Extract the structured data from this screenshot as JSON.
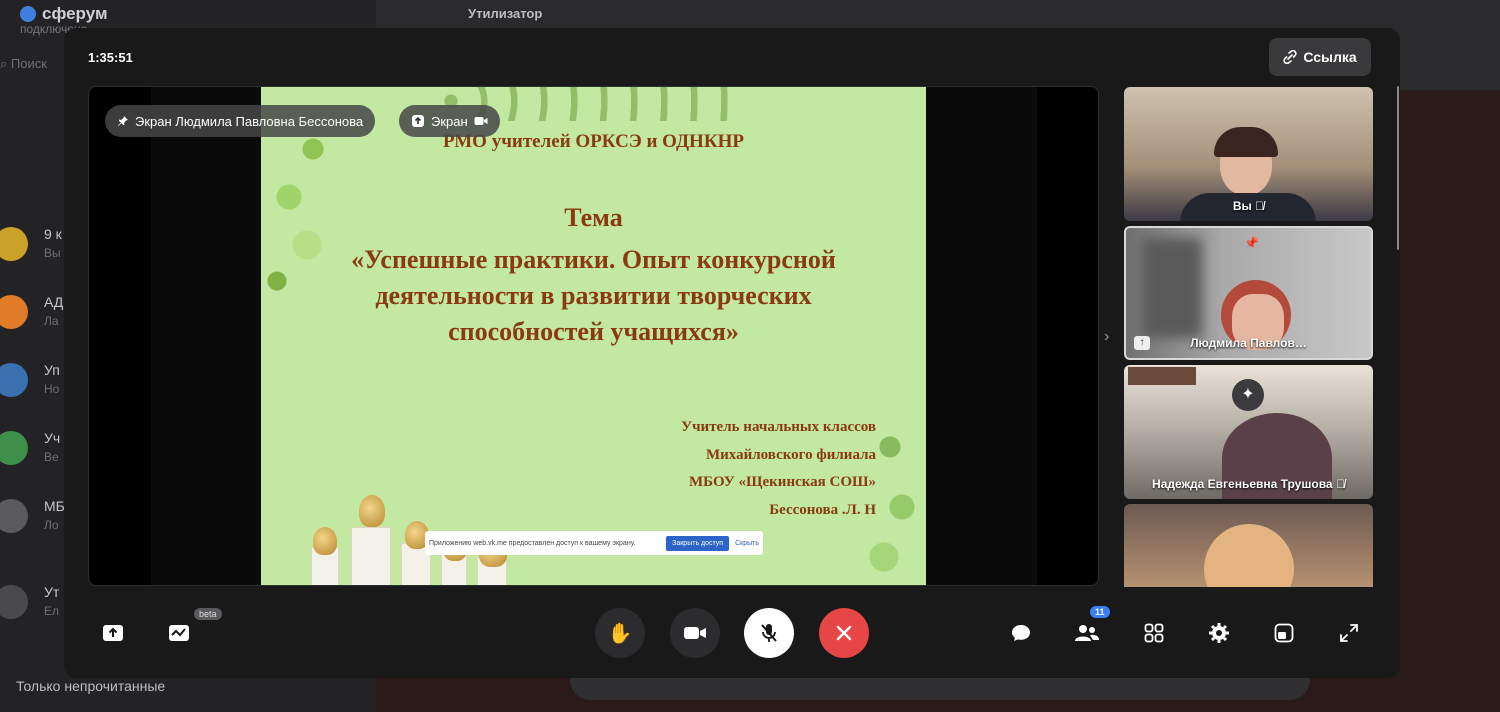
{
  "background_app": {
    "brand": "сферум",
    "subtitle": "подключено",
    "search_placeholder": "Поиск",
    "chat_title": "Утилизатор",
    "chat_subtitle": "",
    "chats": [
      {
        "name": "9 к",
        "preview": "Вы",
        "color": "#c9a227"
      },
      {
        "name": "АД",
        "preview": "Ла",
        "color": "#e07b2a"
      },
      {
        "name": "Уп",
        "preview": "Но",
        "color": "#3a6fb0"
      },
      {
        "name": "Уч",
        "preview": "Ве",
        "color": "#3e8f4a"
      },
      {
        "name": "МБ",
        "preview": "Ло",
        "color": "#5a5a5e"
      },
      {
        "name": "Ут",
        "preview": "Ел",
        "color": "#4a4a4e"
      }
    ],
    "unread_filter": "Только непрочитанные"
  },
  "call": {
    "timer": "1:35:51",
    "link_label": "Ссылка",
    "pinned_chip": "Экран Людмила Павловна Бессонова",
    "screen_chip": "Экран",
    "slide": {
      "header": "РМО учителей ОРКСЭ  и ОДНКНР",
      "topic_label": "Тема",
      "topic_lines": [
        "«Успешные практики. Опыт конкурсной",
        "деятельности в развитии творческих",
        "способностей учащихся»"
      ],
      "author_lines": [
        "Учитель начальных классов",
        "Михайловского филиала",
        "МБОУ «Щекинская СОШ»",
        "Бессонова .Л. Н"
      ]
    },
    "share_notice": {
      "text": "Приложению web.vk.me предоставлен доступ к вашему экрану.",
      "stop_button": "Закрыть доступ",
      "hide_link": "Скрыть"
    },
    "participants": [
      {
        "name": "Вы",
        "muted": true,
        "bg": "#a99a86"
      },
      {
        "name": "Людмила Павлов…",
        "muted": false,
        "bg": "#9c9c9c"
      },
      {
        "name": "Надежда Евгеньевна Трушова",
        "muted": true,
        "bg": "#8a8680"
      },
      {
        "name": "",
        "muted": false,
        "bg": "#6a5a50"
      }
    ],
    "toolbar": {
      "share_icon": "share-screen-icon",
      "effects_icon": "effects-icon",
      "beta_label": "beta",
      "hand_icon": "raise-hand-icon",
      "camera_icon": "camera-icon",
      "mic_icon": "mic-off-icon",
      "end_icon": "end-call-icon",
      "chat_icon": "chat-icon",
      "participants_icon": "participants-icon",
      "participants_count": "11",
      "grid_icon": "grid-icon",
      "settings_icon": "settings-icon",
      "layout_icon": "layout-icon",
      "fullscreen_icon": "fullscreen-icon"
    },
    "colors": {
      "end_call": "#e64646",
      "badge": "#3a7ff0",
      "slide_bg": "#c3e8a2",
      "slide_text": "#8a3a10"
    }
  }
}
